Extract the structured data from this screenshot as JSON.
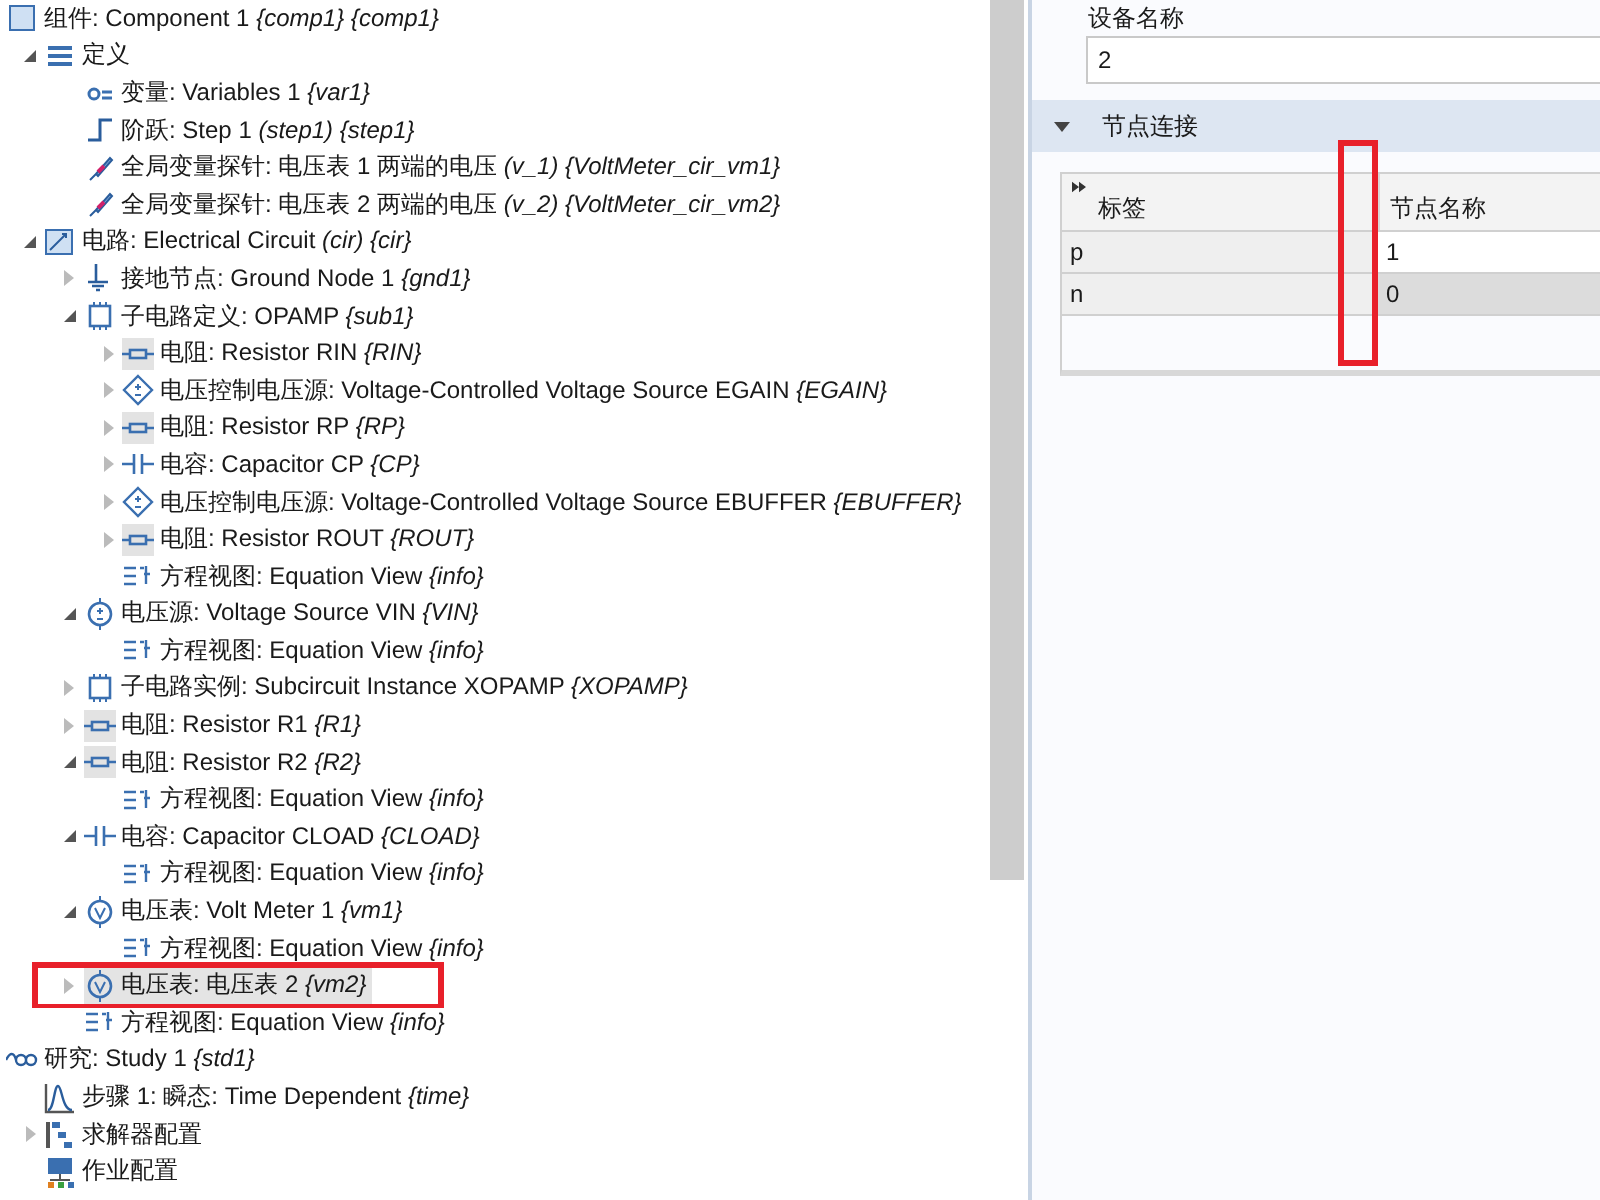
{
  "tree": [
    {
      "kind": "component",
      "label": "组件: Component 1 *{comp1} {comp1}*",
      "selected": false,
      "children": [
        {
          "kind": "list",
          "label": "定义",
          "expanded": true,
          "selected": false,
          "children": [
            {
              "kind": "variable",
              "label": "变量: Variables 1 *{var1}*",
              "selected": false
            },
            {
              "kind": "step",
              "label": "阶跃: Step 1 *(step1) {step1}*",
              "selected": false
            },
            {
              "kind": "probe",
              "label": "全局变量探针: 电压表 1 两端的电压 *(v_1) {VoltMeter_cir_vm1}*",
              "selected": false
            },
            {
              "kind": "probe",
              "label": "全局变量探针: 电压表 2 两端的电压 *(v_2) {VoltMeter_cir_vm2}*",
              "selected": false
            }
          ]
        },
        {
          "kind": "circuit",
          "label": "电路: Electrical Circuit *(cir) {cir}*",
          "expanded": true,
          "selected": false,
          "children": [
            {
              "kind": "ground",
              "label": "接地节点: Ground Node 1 *{gnd1}*",
              "expanded": false,
              "selected": false
            },
            {
              "kind": "subcircuit",
              "label": "子电路定义: OPAMP *{sub1}*",
              "expanded": true,
              "selected": false,
              "children": [
                {
                  "kind": "resistor",
                  "label": "电阻: Resistor RIN *{RIN}*",
                  "expanded": false,
                  "selected": false
                },
                {
                  "kind": "vcvs",
                  "label": "电压控制电压源: Voltage-Controlled Voltage Source EGAIN *{EGAIN}*",
                  "expanded": false,
                  "selected": false
                },
                {
                  "kind": "resistor",
                  "label": "电阻: Resistor RP *{RP}*",
                  "expanded": false,
                  "selected": false
                },
                {
                  "kind": "capacitor",
                  "label": "电容: Capacitor CP *{CP}*",
                  "expanded": false,
                  "selected": false
                },
                {
                  "kind": "vcvs",
                  "label": "电压控制电压源: Voltage-Controlled Voltage Source EBUFFER *{EBUFFER}*",
                  "expanded": false,
                  "selected": false
                },
                {
                  "kind": "resistor",
                  "label": "电阻: Resistor ROUT *{ROUT}*",
                  "expanded": false,
                  "selected": false
                },
                {
                  "kind": "equation",
                  "label": "方程视图: Equation View *{info}*",
                  "selected": false
                }
              ]
            },
            {
              "kind": "vsource",
              "label": "电压源: Voltage Source VIN *{VIN}*",
              "expanded": true,
              "selected": false,
              "children": [
                {
                  "kind": "equation",
                  "label": "方程视图: Equation View *{info}*",
                  "selected": false
                }
              ]
            },
            {
              "kind": "subcircuit",
              "label": "子电路实例: Subcircuit Instance XOPAMP *{XOPAMP}*",
              "expanded": false,
              "selected": false
            },
            {
              "kind": "resistor",
              "label": "电阻: Resistor R1 *{R1}*",
              "expanded": false,
              "selected": false
            },
            {
              "kind": "resistor",
              "label": "电阻: Resistor R2 *{R2}*",
              "expanded": true,
              "selected": false,
              "children": [
                {
                  "kind": "equation",
                  "label": "方程视图: Equation View *{info}*",
                  "selected": false
                }
              ]
            },
            {
              "kind": "capacitor",
              "label": "电容: Capacitor CLOAD *{CLOAD}*",
              "expanded": true,
              "selected": false,
              "children": [
                {
                  "kind": "equation",
                  "label": "方程视图: Equation View *{info}*",
                  "selected": false
                }
              ]
            },
            {
              "kind": "voltmeter",
              "label": "电压表: Volt Meter 1 *{vm1}*",
              "expanded": true,
              "selected": false,
              "children": [
                {
                  "kind": "equation",
                  "label": "方程视图: Equation View *{info}*",
                  "selected": false
                }
              ]
            },
            {
              "kind": "voltmeter",
              "label": "电压表: 电压表 2 *{vm2}*",
              "expanded": false,
              "selected": true
            },
            {
              "kind": "equation",
              "label": "方程视图: Equation View *{info}*",
              "selected": false
            }
          ]
        }
      ]
    },
    {
      "kind": "study",
      "label": "研究: Study 1 *{std1}*",
      "selected": false,
      "children": [
        {
          "kind": "timestep",
          "label": "步骤 1: 瞬态: Time Dependent *{time}*",
          "selected": false
        },
        {
          "kind": "solver",
          "label": "求解器配置",
          "expanded": false,
          "selected": false
        },
        {
          "kind": "job",
          "label": "作业配置",
          "selected": false
        }
      ]
    }
  ],
  "properties": {
    "name_label": "设备名称",
    "name_value": "2",
    "section": {
      "title": "节点连接",
      "expanded": true
    },
    "table": {
      "columns": [
        "标签",
        "节点名称"
      ],
      "rows": [
        {
          "cells": [
            "p",
            "1"
          ],
          "selected": false
        },
        {
          "cells": [
            "n",
            "0"
          ],
          "selected": true
        }
      ]
    }
  }
}
